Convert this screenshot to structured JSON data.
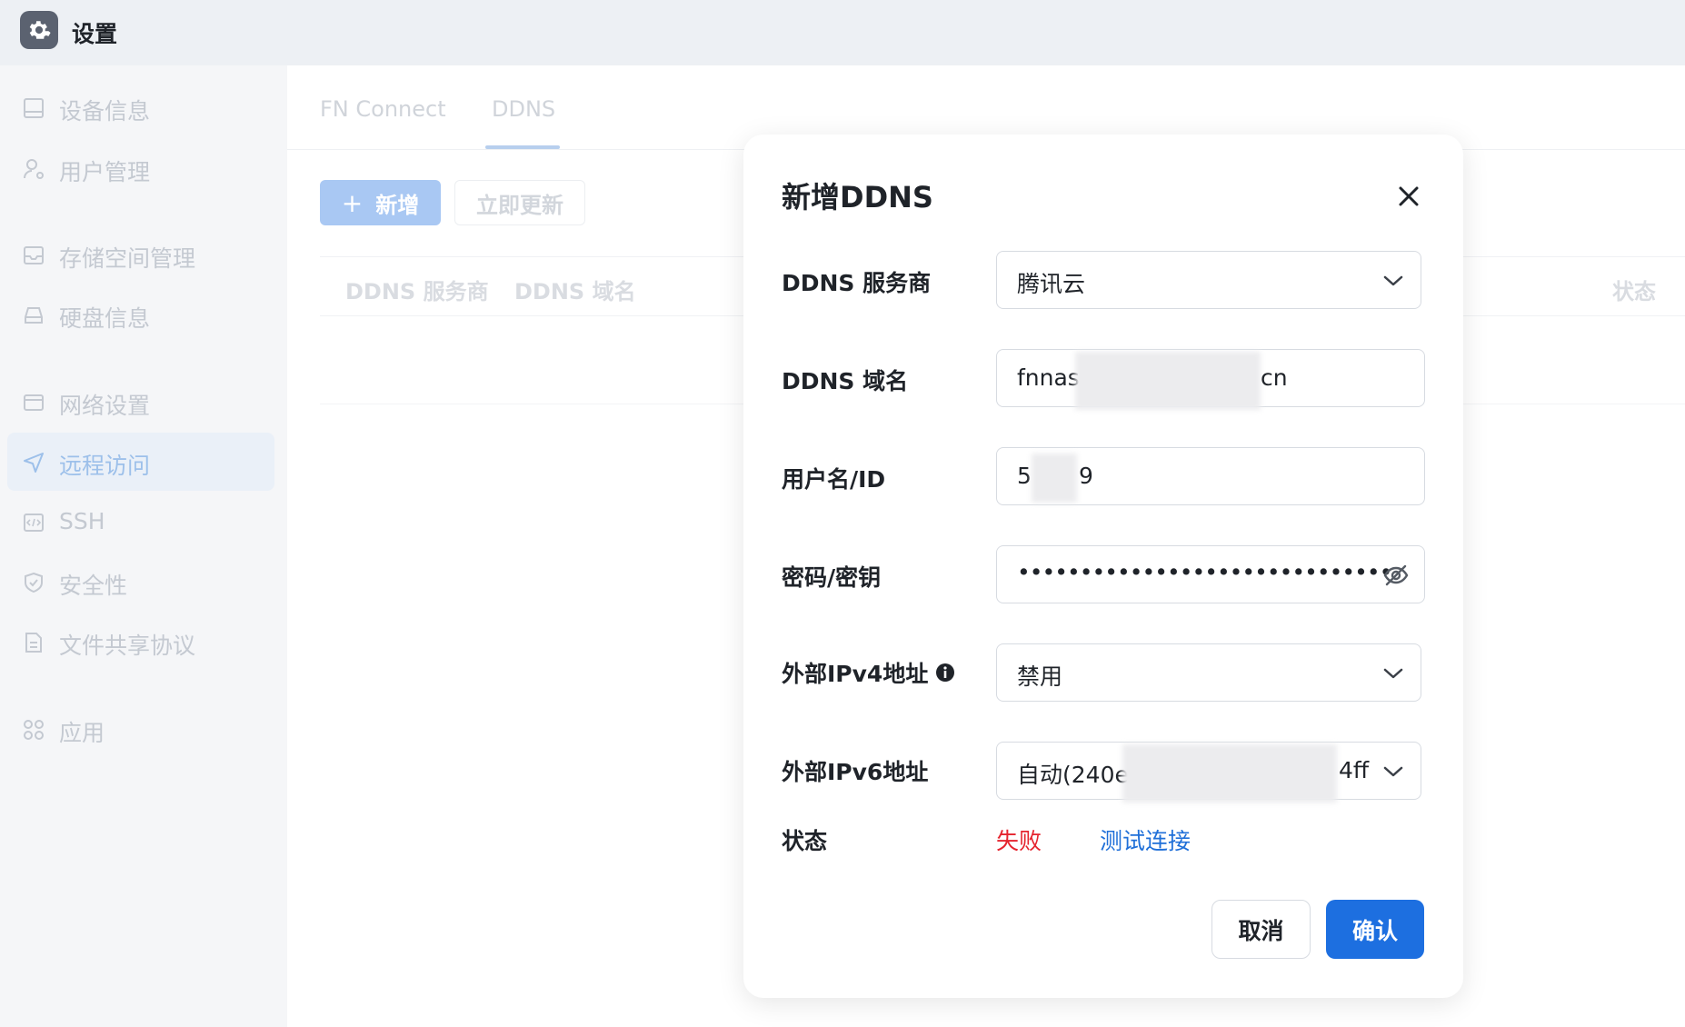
{
  "app": {
    "title": "设置",
    "icon": "gear-icon"
  },
  "sidebar": {
    "items": [
      {
        "label": "设备信息",
        "icon": "device-icon"
      },
      {
        "label": "用户管理",
        "icon": "user-icon"
      },
      {
        "label": "存储空间管理",
        "icon": "storage-icon"
      },
      {
        "label": "硬盘信息",
        "icon": "disk-icon"
      },
      {
        "label": "网络设置",
        "icon": "network-icon"
      },
      {
        "label": "远程访问",
        "icon": "send-icon",
        "active": true
      },
      {
        "label": "SSH",
        "icon": "code-icon"
      },
      {
        "label": "安全性",
        "icon": "shield-icon"
      },
      {
        "label": "文件共享协议",
        "icon": "document-icon"
      },
      {
        "label": "应用",
        "icon": "apps-icon"
      }
    ]
  },
  "tabs": [
    {
      "label": "FN Connect"
    },
    {
      "label": "DDNS",
      "active": true
    }
  ],
  "toolbar": {
    "add_label": "新增",
    "refresh_label": "立即更新"
  },
  "table": {
    "columns": [
      "DDNS 服务商",
      "DDNS 域名",
      "状态"
    ]
  },
  "dialog": {
    "title": "新增DDNS",
    "fields": {
      "provider": {
        "label": "DDNS 服务商",
        "value": "腾讯云"
      },
      "domain": {
        "label": "DDNS 域名",
        "value_prefix": "fnnas.",
        "value_suffix": "cn"
      },
      "username": {
        "label": "用户名/ID",
        "value_prefix": "5",
        "value_suffix": "9"
      },
      "password": {
        "label": "密码/密钥",
        "value": "••••••••••••••••••••••••••••••"
      },
      "ipv4": {
        "label": "外部IPv4地址",
        "value": "禁用"
      },
      "ipv6": {
        "label": "外部IPv6地址",
        "value_prefix": "自动(240e:",
        "value_suffix": "4ff"
      }
    },
    "status": {
      "label": "状态",
      "value": "失败",
      "test_link": "测试连接"
    },
    "cancel_label": "取消",
    "confirm_label": "确认",
    "colors": {
      "primary": "#1d6fe0",
      "error": "#e5242e",
      "link": "#1f6fd8"
    }
  }
}
